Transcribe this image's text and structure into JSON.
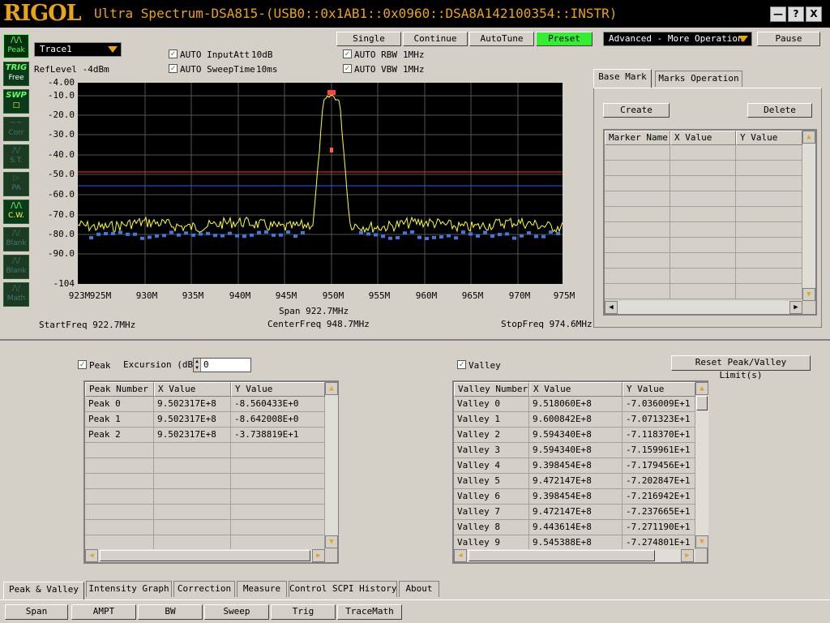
{
  "titlebar": {
    "logo": "RIGOL",
    "title": "Ultra Spectrum-DSA815-(USB0::0x1AB1::0x0960::DSA8A142100354::INSTR)",
    "minimize": "—",
    "help": "?",
    "close": "X"
  },
  "sidebar": [
    {
      "name": "peak",
      "label": "Peak",
      "top": ""
    },
    {
      "name": "trig",
      "label": "Free",
      "top": "TRIG"
    },
    {
      "name": "swp",
      "label": "",
      "top": "SWP"
    },
    {
      "name": "corr",
      "label": "Corr",
      "top": ""
    },
    {
      "name": "st",
      "label": "S.T.",
      "top": ""
    },
    {
      "name": "pa",
      "label": "PA",
      "top": ""
    },
    {
      "name": "cw",
      "label": "C.W.",
      "top": ""
    },
    {
      "name": "blank1",
      "label": "Blank",
      "top": ""
    },
    {
      "name": "blank2",
      "label": "Blank",
      "top": ""
    },
    {
      "name": "math",
      "label": "Math",
      "top": ""
    }
  ],
  "trace_select": "Trace1",
  "ref_level": "RefLevel  -4dBm",
  "auto_input_att": {
    "label": "AUTO InputAtt",
    "value": "10dB"
  },
  "auto_sweep_time": {
    "label": "AUTO SweepTime",
    "value": "10ms"
  },
  "auto_rbw": {
    "label": "AUTO RBW",
    "value": "1MHz"
  },
  "auto_vbw": {
    "label": "AUTO VBW",
    "value": "1MHz"
  },
  "toolbar": {
    "single": "Single",
    "continue": "Continue",
    "autotune": "AutoTune",
    "preset": "Preset",
    "advanced": "Advanced - More Operation",
    "pause": "Pause"
  },
  "plot": {
    "y_ticks": [
      "-4.00",
      "-10.0",
      "-20.0",
      "-30.0",
      "-40.0",
      "-50.0",
      "-60.0",
      "-70.0",
      "-80.0",
      "-90.0",
      "-104"
    ],
    "x_ticks": [
      "923M",
      "925M",
      "930M",
      "935M",
      "940M",
      "945M",
      "950M",
      "955M",
      "960M",
      "965M",
      "970M",
      "975M"
    ],
    "span": "Span  922.7MHz",
    "start_freq": "StartFreq  922.7MHz",
    "center_freq": "CenterFreq  948.7MHz",
    "stop_freq": "StopFreq  974.6MHz",
    "trace_color": "#ffff33",
    "peak_line_color": "#ff3333",
    "valley_line_color": "#3355ff"
  },
  "marker_panel": {
    "tabs": [
      "Base Mark",
      "Marks Operation"
    ],
    "create": "Create",
    "delete": "Delete",
    "columns": [
      "Marker Name",
      "X Value",
      "Y Value"
    ]
  },
  "peak_panel": {
    "enabled_label": "Peak",
    "excursion_label": "Excursion (dB)",
    "excursion_value": "0",
    "columns": [
      "Peak Number",
      "X Value",
      "Y Value"
    ],
    "rows": [
      [
        "Peak 0",
        "9.502317E+8",
        "-8.560433E+0"
      ],
      [
        "Peak 1",
        "9.502317E+8",
        "-8.642008E+0"
      ],
      [
        "Peak 2",
        "9.502317E+8",
        "-3.738819E+1"
      ]
    ]
  },
  "valley_panel": {
    "enabled_label": "Valley",
    "reset_button": "Reset Peak/Valley Limit(s)",
    "columns": [
      "Valley Number",
      "X Value",
      "Y Value"
    ],
    "rows": [
      [
        "Valley 0",
        "9.518060E+8",
        "-7.036009E+1"
      ],
      [
        "Valley 1",
        "9.600842E+8",
        "-7.071323E+1"
      ],
      [
        "Valley 2",
        "9.594340E+8",
        "-7.118370E+1"
      ],
      [
        "Valley 3",
        "9.594340E+8",
        "-7.159961E+1"
      ],
      [
        "Valley 4",
        "9.398454E+8",
        "-7.179456E+1"
      ],
      [
        "Valley 5",
        "9.472147E+8",
        "-7.202847E+1"
      ],
      [
        "Valley 6",
        "9.398454E+8",
        "-7.216942E+1"
      ],
      [
        "Valley 7",
        "9.472147E+8",
        "-7.237665E+1"
      ],
      [
        "Valley 8",
        "9.443614E+8",
        "-7.271190E+1"
      ],
      [
        "Valley 9",
        "9.545388E+8",
        "-7.274801E+1"
      ]
    ]
  },
  "bottom_tabs": [
    "Peak & Valley",
    "Intensity Graph",
    "Correction",
    "Measure",
    "Control SCPI History",
    "About"
  ],
  "footer_buttons": [
    "Span",
    "AMPT",
    "BW",
    "Sweep",
    "Trig",
    "TraceMath"
  ]
}
